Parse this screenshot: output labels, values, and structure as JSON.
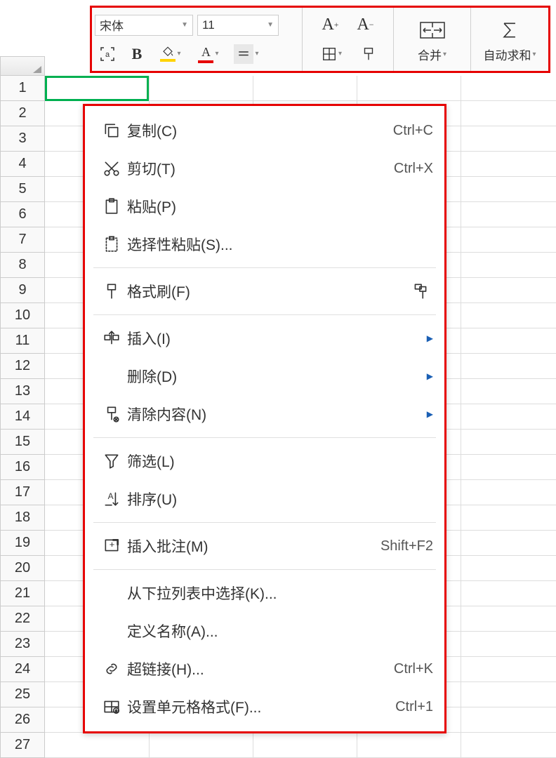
{
  "toolbar": {
    "font_name": "宋体",
    "font_size": "11",
    "increase_font": "A⁺",
    "decrease_font": "A⁻",
    "merge_label": "合并",
    "autosum_label": "自动求和",
    "bold_label": "B"
  },
  "grid": {
    "rows": [
      1,
      2,
      3,
      4,
      5,
      6,
      7,
      8,
      9,
      10,
      11,
      12,
      13,
      14,
      15,
      16,
      17,
      18,
      19,
      20,
      21,
      22,
      23,
      24,
      25,
      26,
      27
    ]
  },
  "context_menu": [
    {
      "icon": "copy",
      "label": "复制(C)",
      "shortcut": "Ctrl+C",
      "type": "item"
    },
    {
      "icon": "cut",
      "label": "剪切(T)",
      "shortcut": "Ctrl+X",
      "type": "item"
    },
    {
      "icon": "paste",
      "label": "粘贴(P)",
      "shortcut": "",
      "type": "item"
    },
    {
      "icon": "paste-special",
      "label": "选择性粘贴(S)...",
      "shortcut": "",
      "type": "item"
    },
    {
      "type": "sep"
    },
    {
      "icon": "format-painter",
      "label": "格式刷(F)",
      "shortcut": "",
      "extra_icon": "format-painter2",
      "type": "item"
    },
    {
      "type": "sep"
    },
    {
      "icon": "insert",
      "label": "插入(I)",
      "arrow": true,
      "type": "item"
    },
    {
      "icon": "",
      "label": "删除(D)",
      "arrow": true,
      "type": "item"
    },
    {
      "icon": "clear",
      "label": "清除内容(N)",
      "arrow": true,
      "type": "item"
    },
    {
      "type": "sep"
    },
    {
      "icon": "filter",
      "label": "筛选(L)",
      "shortcut": "",
      "type": "item"
    },
    {
      "icon": "sort",
      "label": "排序(U)",
      "shortcut": "",
      "type": "item"
    },
    {
      "type": "sep"
    },
    {
      "icon": "comment",
      "label": "插入批注(M)",
      "shortcut": "Shift+F2",
      "type": "item"
    },
    {
      "type": "sep"
    },
    {
      "icon": "",
      "label": "从下拉列表中选择(K)...",
      "shortcut": "",
      "type": "item"
    },
    {
      "icon": "",
      "label": "定义名称(A)...",
      "shortcut": "",
      "type": "item"
    },
    {
      "icon": "link",
      "label": "超链接(H)...",
      "shortcut": "Ctrl+K",
      "type": "item"
    },
    {
      "icon": "cell-format",
      "label": "设置单元格格式(F)...",
      "shortcut": "Ctrl+1",
      "type": "item"
    }
  ]
}
